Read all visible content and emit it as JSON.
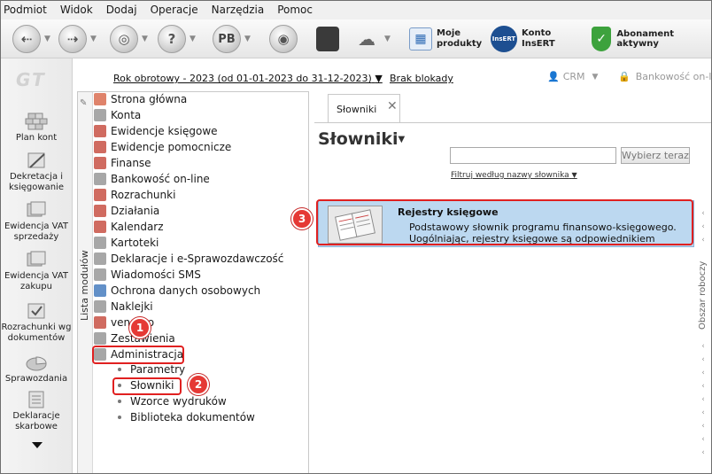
{
  "menu": [
    "Podmiot",
    "Widok",
    "Dodaj",
    "Operacje",
    "Narzędzia",
    "Pomoc"
  ],
  "toolbar": {
    "pb_label": "PB",
    "moje_produkty": [
      "Moje",
      "produkty"
    ],
    "konto_insert": [
      "Konto",
      "InsERT"
    ],
    "abonament": "Abonament aktywny"
  },
  "logo": "GT",
  "leftbar": [
    {
      "label": "Plan kont"
    },
    {
      "label": "Dekretacja i księgowanie"
    },
    {
      "label": "Ewidencja VAT sprzedaży"
    },
    {
      "label": "Ewidencja VAT zakupu"
    },
    {
      "label": "Rozrachunki wg dokumentów"
    },
    {
      "label": "Sprawozdania"
    },
    {
      "label": "Deklaracje skarbowe"
    }
  ],
  "yearbar": {
    "rok": "Rok obrotowy - 2023  (od 01-01-2023 do 31-12-2023)",
    "brak": "Brak blokady",
    "crm": "CRM",
    "bank": "Bankowość on-lin"
  },
  "modules": {
    "title": "Lista modułów",
    "items": [
      "Strona główna",
      "Konta",
      "Ewidencje księgowe",
      "Ewidencje pomocnicze",
      "Finanse",
      "Bankowość on-line",
      "Rozrachunki",
      "Działania",
      "Kalendarz",
      "Kartoteki",
      "Deklaracje i e-Sprawozdawczość",
      "Wiadomości SMS",
      "Ochrona danych osobowych",
      "Naklejki",
      "vendero",
      "Zestawienia",
      "Administracja"
    ],
    "subitems": [
      "Parametry",
      "Słowniki",
      "Wzorce wydruków",
      "Biblioteka dokumentów"
    ]
  },
  "tab": {
    "label": "Słowniki",
    "close": "✕"
  },
  "main": {
    "title": "Słowniki",
    "search_value": "",
    "search_button": "Wybierz teraz",
    "filter_label": "Filtruj według nazwy słownika",
    "card": {
      "title": "Rejestry księgowe",
      "desc1": "Podstawowy słownik programu finansowo-księgowego.",
      "desc2": "Uogólniając, rejestry księgowe są odpowiednikiem"
    }
  },
  "right_panel": "Obszar roboczy",
  "badges": [
    "1",
    "2",
    "3"
  ],
  "colors": {
    "highlight": "#e02020",
    "badge": "#e53935",
    "card_bg": "#bcd8f0"
  }
}
